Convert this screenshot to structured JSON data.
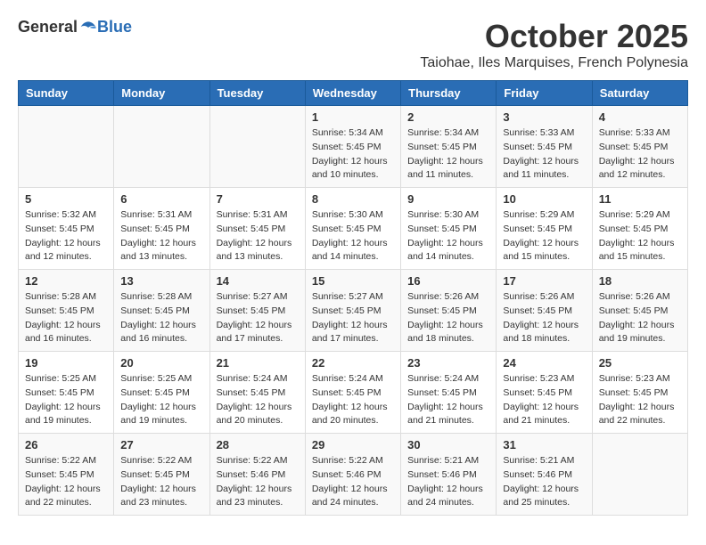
{
  "header": {
    "logo_general": "General",
    "logo_blue": "Blue",
    "month_title": "October 2025",
    "location": "Taiohae, Iles Marquises, French Polynesia"
  },
  "days_of_week": [
    "Sunday",
    "Monday",
    "Tuesday",
    "Wednesday",
    "Thursday",
    "Friday",
    "Saturday"
  ],
  "weeks": [
    [
      {
        "day": "",
        "info": ""
      },
      {
        "day": "",
        "info": ""
      },
      {
        "day": "",
        "info": ""
      },
      {
        "day": "1",
        "info": "Sunrise: 5:34 AM\nSunset: 5:45 PM\nDaylight: 12 hours\nand 10 minutes."
      },
      {
        "day": "2",
        "info": "Sunrise: 5:34 AM\nSunset: 5:45 PM\nDaylight: 12 hours\nand 11 minutes."
      },
      {
        "day": "3",
        "info": "Sunrise: 5:33 AM\nSunset: 5:45 PM\nDaylight: 12 hours\nand 11 minutes."
      },
      {
        "day": "4",
        "info": "Sunrise: 5:33 AM\nSunset: 5:45 PM\nDaylight: 12 hours\nand 12 minutes."
      }
    ],
    [
      {
        "day": "5",
        "info": "Sunrise: 5:32 AM\nSunset: 5:45 PM\nDaylight: 12 hours\nand 12 minutes."
      },
      {
        "day": "6",
        "info": "Sunrise: 5:31 AM\nSunset: 5:45 PM\nDaylight: 12 hours\nand 13 minutes."
      },
      {
        "day": "7",
        "info": "Sunrise: 5:31 AM\nSunset: 5:45 PM\nDaylight: 12 hours\nand 13 minutes."
      },
      {
        "day": "8",
        "info": "Sunrise: 5:30 AM\nSunset: 5:45 PM\nDaylight: 12 hours\nand 14 minutes."
      },
      {
        "day": "9",
        "info": "Sunrise: 5:30 AM\nSunset: 5:45 PM\nDaylight: 12 hours\nand 14 minutes."
      },
      {
        "day": "10",
        "info": "Sunrise: 5:29 AM\nSunset: 5:45 PM\nDaylight: 12 hours\nand 15 minutes."
      },
      {
        "day": "11",
        "info": "Sunrise: 5:29 AM\nSunset: 5:45 PM\nDaylight: 12 hours\nand 15 minutes."
      }
    ],
    [
      {
        "day": "12",
        "info": "Sunrise: 5:28 AM\nSunset: 5:45 PM\nDaylight: 12 hours\nand 16 minutes."
      },
      {
        "day": "13",
        "info": "Sunrise: 5:28 AM\nSunset: 5:45 PM\nDaylight: 12 hours\nand 16 minutes."
      },
      {
        "day": "14",
        "info": "Sunrise: 5:27 AM\nSunset: 5:45 PM\nDaylight: 12 hours\nand 17 minutes."
      },
      {
        "day": "15",
        "info": "Sunrise: 5:27 AM\nSunset: 5:45 PM\nDaylight: 12 hours\nand 17 minutes."
      },
      {
        "day": "16",
        "info": "Sunrise: 5:26 AM\nSunset: 5:45 PM\nDaylight: 12 hours\nand 18 minutes."
      },
      {
        "day": "17",
        "info": "Sunrise: 5:26 AM\nSunset: 5:45 PM\nDaylight: 12 hours\nand 18 minutes."
      },
      {
        "day": "18",
        "info": "Sunrise: 5:26 AM\nSunset: 5:45 PM\nDaylight: 12 hours\nand 19 minutes."
      }
    ],
    [
      {
        "day": "19",
        "info": "Sunrise: 5:25 AM\nSunset: 5:45 PM\nDaylight: 12 hours\nand 19 minutes."
      },
      {
        "day": "20",
        "info": "Sunrise: 5:25 AM\nSunset: 5:45 PM\nDaylight: 12 hours\nand 19 minutes."
      },
      {
        "day": "21",
        "info": "Sunrise: 5:24 AM\nSunset: 5:45 PM\nDaylight: 12 hours\nand 20 minutes."
      },
      {
        "day": "22",
        "info": "Sunrise: 5:24 AM\nSunset: 5:45 PM\nDaylight: 12 hours\nand 20 minutes."
      },
      {
        "day": "23",
        "info": "Sunrise: 5:24 AM\nSunset: 5:45 PM\nDaylight: 12 hours\nand 21 minutes."
      },
      {
        "day": "24",
        "info": "Sunrise: 5:23 AM\nSunset: 5:45 PM\nDaylight: 12 hours\nand 21 minutes."
      },
      {
        "day": "25",
        "info": "Sunrise: 5:23 AM\nSunset: 5:45 PM\nDaylight: 12 hours\nand 22 minutes."
      }
    ],
    [
      {
        "day": "26",
        "info": "Sunrise: 5:22 AM\nSunset: 5:45 PM\nDaylight: 12 hours\nand 22 minutes."
      },
      {
        "day": "27",
        "info": "Sunrise: 5:22 AM\nSunset: 5:45 PM\nDaylight: 12 hours\nand 23 minutes."
      },
      {
        "day": "28",
        "info": "Sunrise: 5:22 AM\nSunset: 5:46 PM\nDaylight: 12 hours\nand 23 minutes."
      },
      {
        "day": "29",
        "info": "Sunrise: 5:22 AM\nSunset: 5:46 PM\nDaylight: 12 hours\nand 24 minutes."
      },
      {
        "day": "30",
        "info": "Sunrise: 5:21 AM\nSunset: 5:46 PM\nDaylight: 12 hours\nand 24 minutes."
      },
      {
        "day": "31",
        "info": "Sunrise: 5:21 AM\nSunset: 5:46 PM\nDaylight: 12 hours\nand 25 minutes."
      },
      {
        "day": "",
        "info": ""
      }
    ]
  ]
}
